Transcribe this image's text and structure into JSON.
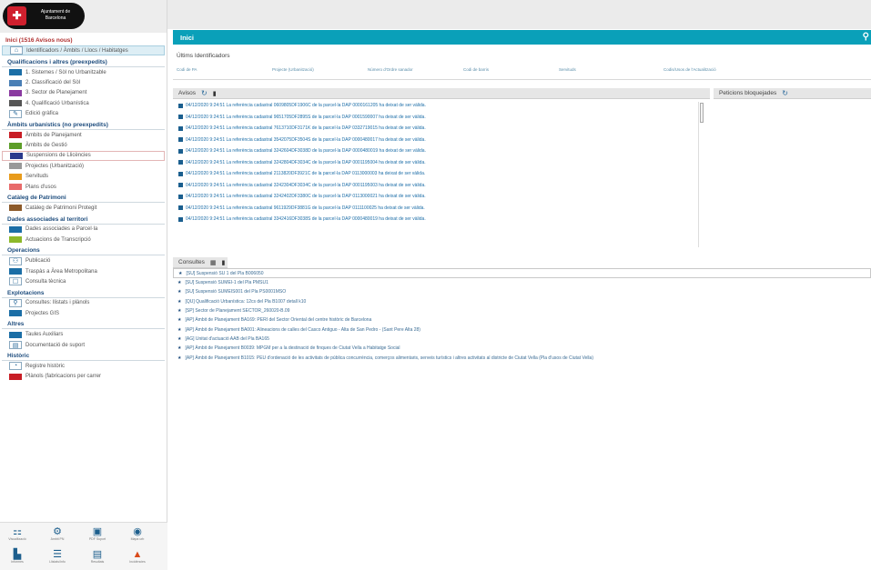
{
  "sidebar": {
    "logo_text": "Ajuntament de Barcelona",
    "session_title": "Inici (1516 Avisos nous)",
    "top_item": "Identificadors / Àmbits / Llocs / Habitatges",
    "categories": [
      {
        "title": "Qualificacions i altres (preexpedits)",
        "items": [
          {
            "label": "1. Sistemes / Sòl no Urbanitzable",
            "color": "#1b6ea6"
          },
          {
            "label": "2. Classificació del Sòl",
            "color": "#4a7fb5"
          },
          {
            "label": "3. Sector de Planejament",
            "color": "#8a3aa0"
          },
          {
            "label": "4. Qualificació Urbanística",
            "color": "#555555"
          },
          {
            "label": "Edició gràfica",
            "icon": "pencil-icon"
          }
        ]
      },
      {
        "title": "Àmbits urbanístics (no preexpedits)",
        "items": [
          {
            "label": "Àmbits de Planejament",
            "color": "#c81d25"
          },
          {
            "label": "Àmbits de Gestió",
            "color": "#5c9d28"
          },
          {
            "label": "Suspensions de Llicències",
            "color": "#2a3a8c",
            "selected": true
          },
          {
            "label": "Projectes (Urbanització)",
            "color": "#999999"
          },
          {
            "label": "Servituds",
            "color": "#e89b1b"
          },
          {
            "label": "Plans d'usos",
            "color": "#e86a6a"
          }
        ]
      },
      {
        "title": "Catàleg de Patrimoni",
        "items": [
          {
            "label": "Catàleg de Patrimoni Protegit",
            "color": "#8c5a2a"
          }
        ]
      },
      {
        "title": "Dades associades al territori",
        "items": [
          {
            "label": "Dades associades a Parcel·la",
            "color": "#1b6ea6"
          },
          {
            "label": "Actuacions de Transcripció",
            "color": "#8db82a"
          }
        ]
      },
      {
        "title": "Operacions",
        "items": [
          {
            "label": "Publicació",
            "icon": "network-icon"
          },
          {
            "label": "Traspàs a Àrea Metropolitana",
            "color": "#1b6ea6"
          },
          {
            "label": "Consulta tècnica",
            "icon": "clipboard-icon"
          }
        ]
      },
      {
        "title": "Explotacions",
        "items": [
          {
            "label": "Consultes: llistats i plànols",
            "icon": "search-doc-icon"
          },
          {
            "label": "Projectes GIS",
            "color": "#1b6ea6"
          }
        ]
      },
      {
        "title": "Altres",
        "items": [
          {
            "label": "Taules Auxiliars",
            "color": "#1b6ea6"
          },
          {
            "label": "Documentació de suport",
            "icon": "doc-icon"
          }
        ]
      },
      {
        "title": "Històric",
        "items": [
          {
            "label": "Registre històric",
            "icon": "history-icon"
          },
          {
            "label": "Plànols (fabricacions per carrer",
            "color": "#c81d25"
          }
        ]
      }
    ],
    "tools": [
      {
        "label": "Visualització",
        "glyph": "⚏"
      },
      {
        "label": "Àmbit PN",
        "glyph": "⚙"
      },
      {
        "label": "PDF Suport",
        "glyph": "▣"
      },
      {
        "label": "Mapa urb",
        "glyph": "◉"
      },
      {
        "label": "Informes",
        "glyph": "▙"
      },
      {
        "label": "Llistats/Info",
        "glyph": "☰"
      },
      {
        "label": "Resultats",
        "glyph": "▤"
      },
      {
        "label": "Incidències",
        "glyph": "▲"
      }
    ]
  },
  "main": {
    "title": "Inici",
    "ident": {
      "label": "Últims Identificadors",
      "columns": [
        "Codi de PA",
        "Projecte (Urbanització)",
        "Número d'Ordre sanador",
        "Codi de barris",
        "Servituds",
        "Codis/Usos de l'Actualització"
      ]
    },
    "avisos": {
      "title": "Avisos",
      "rows": [
        "04/12/2020 9:24:51 La referència cadastral 0609805DF1906C de la parcel·la DAP 0000161205 ha deixat de ser vàlida.",
        "04/12/2020 9:24:51 La referència cadastral 9651705DF2895S de la parcel·la DAP 0001590007 ha deixat de ser vàlida.",
        "04/12/2020 9:24:51 La referència cadastral 7613710DF3171K de la parcel·la DAP 0332719015 ha deixat de ser vàlida.",
        "04/12/2020 9:24:51 La referència cadastral 3542075DF3504S de la parcel·la DAP 0000480017 ha deixat de ser vàlida.",
        "04/12/2020 9:24:51 La referència cadastral 3242604DF3038D de la parcel·la DAP 0000480019 ha deixat de ser vàlida.",
        "04/12/2020 9:24:51 La referència cadastral 3242804DF3034C de la parcel·la DAP 0001195004 ha deixat de ser vàlida.",
        "04/12/2020 9:24:51 La referència cadastral 2113820DF3921C de la parcel·la DAP 0113000003 ha deixat de ser vàlida.",
        "04/12/2020 9:24:51 La referència cadastral 3242304DF3034C de la parcel·la DAP 0001195003 ha deixat de ser vàlida.",
        "04/12/2020 9:24:51 La referència cadastral 3242402DF3380C de la parcel·la DAP 0113000021 ha deixat de ser vàlida.",
        "04/12/2020 9:24:51 La referència cadastral 9611929DF3881G de la parcel·la DAP 0111100025 ha deixat de ser vàlida.",
        "04/12/2020 9:24:51 La referència cadastral 3342416DF3038S de la parcel·la DAP 0000480019 ha deixat de ser vàlida."
      ]
    },
    "peticions": {
      "title": "Peticions bloquejades"
    },
    "consultes": {
      "title": "Consultes",
      "rows": [
        "[SU] Suspensió SU 1 del Pla B006050",
        "[SU] Suspensió SUMEI-1 del Pla PMSU1",
        "[SU] Suspensió SUMEIS001 del Pla PS0001MSO",
        "[QU] Qualificació Urbanística: 12cs del Pla B1007 detall k10",
        "[SP] Sector de Planejament SECTOR_260020-B.09",
        "[AP] Àmbit de Planejament BA169: PERI del Sector Oriental del centre històric de Barcelona",
        "[AP] Àmbit de Planejament BA001: Alineacions de calles del Casco Antiguo - Alta de San Pedro - (Sant Pere Alta 28)",
        "[AG] Unitat d'actuació AAB del Pla BA165",
        "[AP] Àmbit de Planejament B0039: MPGM per a la destinació de finques de Ciutat Vella a Habitatge Social",
        "[AP] Àmbit de Planejament B1015: PEU d'ordenació de les activitats de pública concurrència, comerços alimentaris, serveis turístics i altres activitats al districte de Ciutat Vella (Pla d'usos de Ciutat Vella)"
      ]
    }
  }
}
